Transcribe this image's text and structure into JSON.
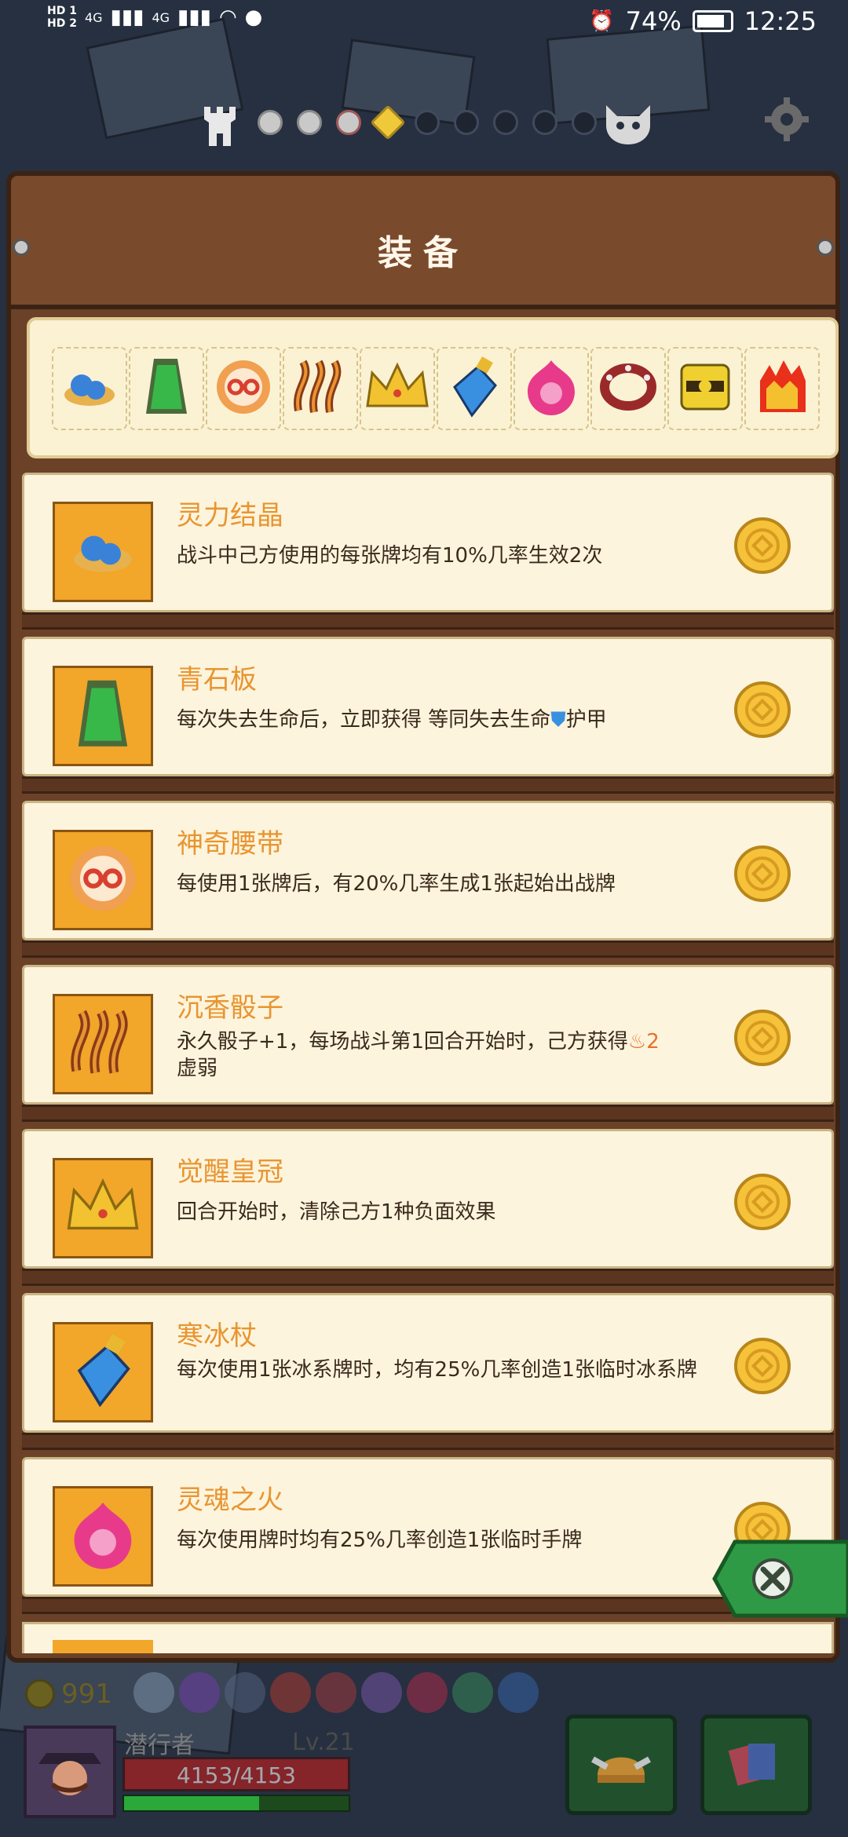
{
  "status_bar": {
    "sim1": "HD 1",
    "sim2": "HD 2",
    "net1": "4G",
    "net2": "4G",
    "battery": "74%",
    "time": "12:25",
    "icons": [
      "signal-icon",
      "wifi-icon",
      "chat-bubble-icon",
      "alarm-icon",
      "battery-icon"
    ]
  },
  "map_track": {
    "nodes": [
      "tower-icon",
      "visited",
      "visited",
      "visited",
      "diamond",
      "empty",
      "empty",
      "empty",
      "empty",
      "empty",
      "boss-icon"
    ],
    "settings_icon": "gear-icon"
  },
  "panel": {
    "title": "装备"
  },
  "equipment_strip": {
    "icons": [
      "spirit-crystal-icon",
      "green-slate-icon",
      "magic-belt-icon",
      "incense-dice-icon",
      "awakened-crown-icon",
      "ice-staff-icon",
      "soul-fire-icon",
      "spiked-bracelet-icon",
      "golden-box-icon",
      "fire-cube-icon"
    ]
  },
  "items": [
    {
      "name": "灵力结晶",
      "desc": "战斗中己方使用的每张牌均有10%几率生效2次",
      "icon": "spirit-crystal-icon"
    },
    {
      "name": "青石板",
      "desc_parts": [
        "每次失去生命后，立即获得 等同失去生命",
        "护甲"
      ],
      "icon": "green-slate-icon"
    },
    {
      "name": "神奇腰带",
      "desc": "每使用1张牌后，有20%几率生成1张起始出战牌",
      "icon": "magic-belt-icon"
    },
    {
      "name": "沉香骰子",
      "desc_parts": [
        "永久骰子+1，每场战斗第1回合开始时，己方获得",
        "2",
        "虚弱"
      ],
      "icon": "incense-dice-icon"
    },
    {
      "name": "觉醒皇冠",
      "desc": "回合开始时，清除己方1种负面效果",
      "icon": "awakened-crown-icon"
    },
    {
      "name": "寒冰杖",
      "desc": "每次使用1张冰系牌时，均有25%几率创造1张临时冰系牌",
      "icon": "ice-staff-icon"
    },
    {
      "name": "灵魂之火",
      "desc": "每次使用牌时均有25%几率创造1张临时手牌",
      "icon": "soul-fire-icon"
    },
    {
      "name": "",
      "desc": "",
      "icon": "partial-item-icon"
    }
  ],
  "hud": {
    "gold": "991",
    "hero_name": "潜行者",
    "hero_level": "Lv.21",
    "hp": "4153/4153",
    "xp_fraction": 0.6,
    "close_icon": "close-icon",
    "deck_icon": "deck-icon",
    "helmet_icon": "helmet-icon"
  },
  "colors": {
    "panel_wood": "#7a4a2c",
    "card_bg": "#fdf4dd",
    "item_name": "#e89530",
    "item_frame": "#f2a62a",
    "close_green": "#2f9a45"
  }
}
